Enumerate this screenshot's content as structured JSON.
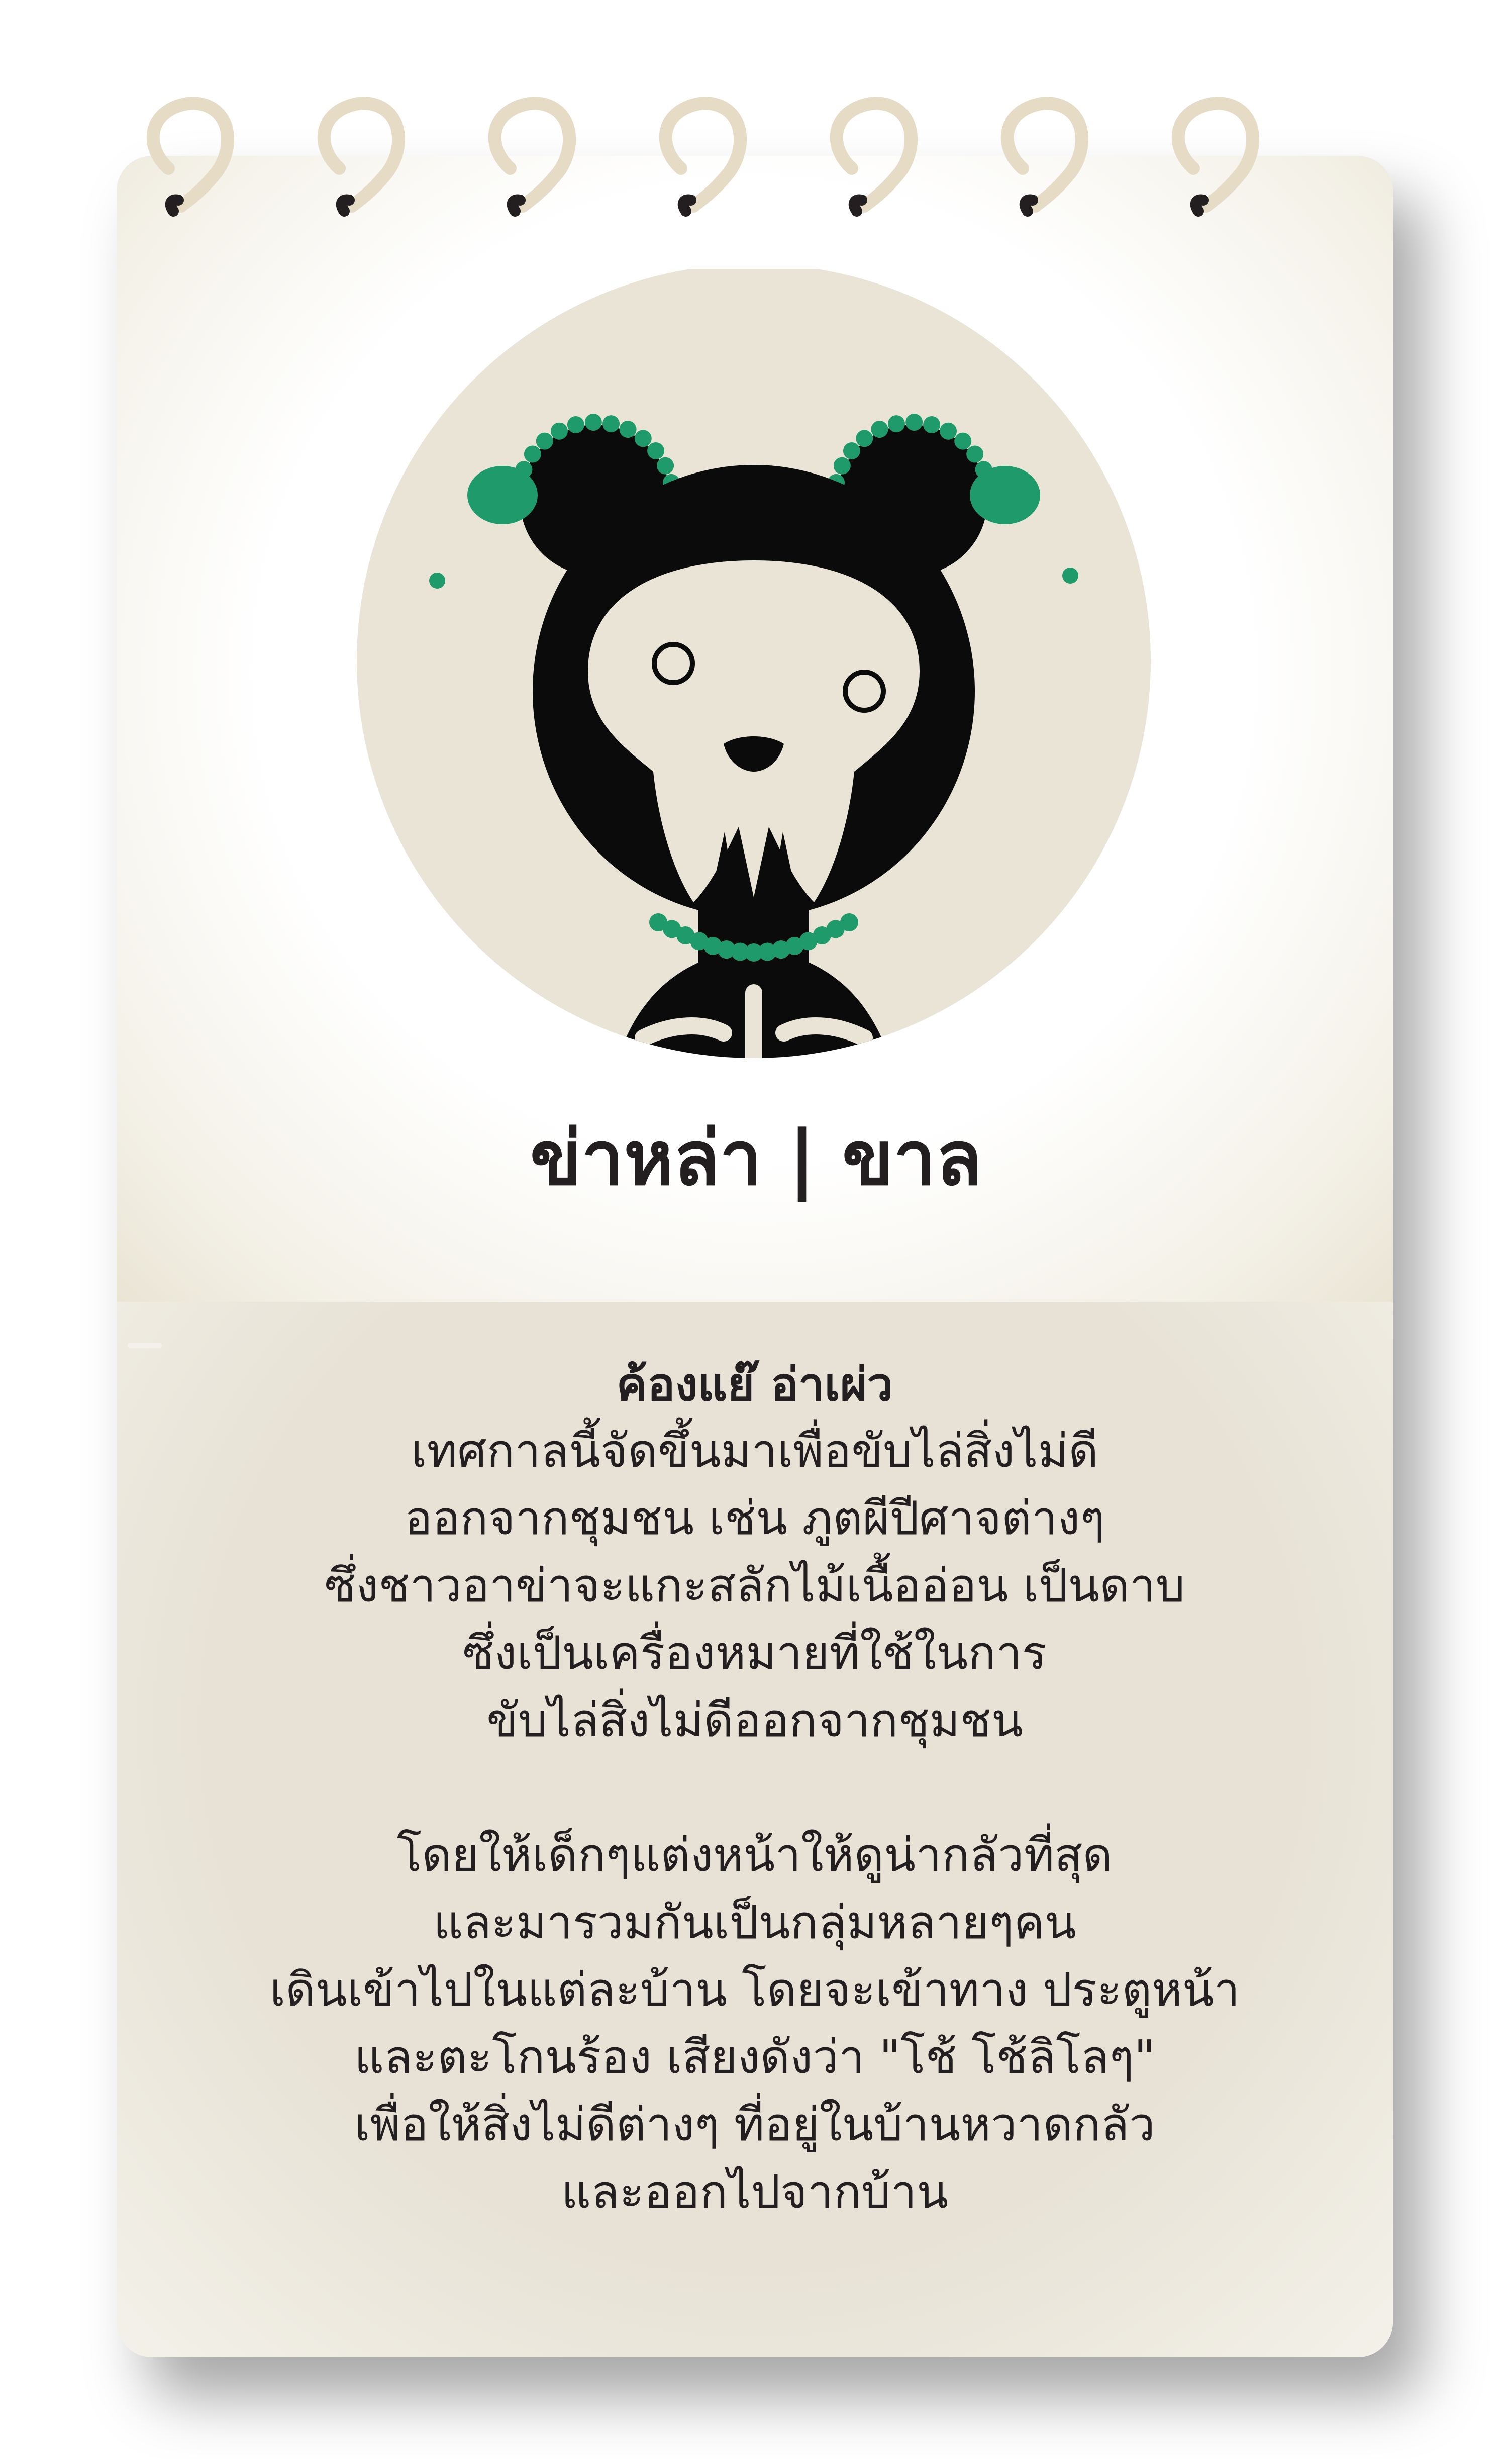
{
  "title": "ข่าหล่า | ขาล",
  "subtitle": "ค้องแย๊ อ่าเผ่ว",
  "paragraphs": [
    [
      "เทศกาลนี้จัดขึ้นมาเพื่อขับไล่สิ่งไม่ดี",
      "ออกจากชุมชน เช่น ภูตผีปีศาจต่างๆ",
      "ซึ่งชาวอาข่าจะแกะสลักไม้เนื้ออ่อน เป็นดาบ",
      "ซึ่งเป็นเครื่องหมายที่ใช้ในการ",
      "ขับไล่สิ่งไม่ดีออกจากชุมชน"
    ],
    [
      "โดยให้เด็กๆแต่งหน้าให้ดูน่ากลัวที่สุด",
      "และมารวมกันเป็นกลุ่มหลายๆคน",
      "เดินเข้าไปในแต่ละบ้าน โดยจะเข้าทาง ประตูหน้า",
      "และตะโกนร้อง เสียงดังว่า \"โช้ โช้ลิโลๆ\"",
      "เพื่อให้สิ่งไม่ดีต่างๆ ที่อยู่ในบ้านหวาดกลัว",
      "และออกไปจากบ้าน"
    ]
  ],
  "colors": {
    "ink": "#231f20",
    "beige": "#e7e2d5",
    "green": "#1f9a6a",
    "ring": "#e6dcc6"
  },
  "icons": [
    "spiral-ring-icon",
    "tiger-skull-mask-illustration"
  ]
}
